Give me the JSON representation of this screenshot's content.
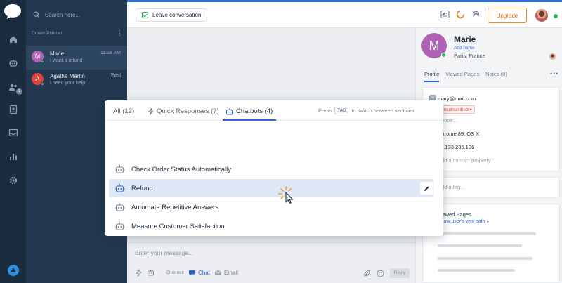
{
  "colors": {
    "accent": "#2a66d6",
    "upgrade": "#e86f12",
    "online": "#2dbd5b",
    "rail": "#1b2c3f",
    "list": "#233850",
    "avatar_marie": "#b063b6",
    "avatar_agathe": "#e0453a"
  },
  "rail": {
    "icons": [
      "chat-bubble-logo-icon",
      "home-icon",
      "bot-icon",
      "visitors-icon",
      "contacts-icon",
      "inbox-icon",
      "analytics-icon",
      "settings-icon",
      "app-logo-icon"
    ],
    "visitors_badge": "1"
  },
  "sidebar": {
    "search_placeholder": "Search here...",
    "section_title": "Dream Planner",
    "more_icon": "more-vertical-icon",
    "conversations": [
      {
        "initial": "M",
        "name": "Marie",
        "time": "11:28 AM",
        "preview": "I want a refund"
      },
      {
        "initial": "A",
        "name": "Agathe Martin",
        "time": "Wed",
        "preview": "I need your help!"
      }
    ]
  },
  "topbar": {
    "leave_label": "Leave conversation",
    "upgrade_label": "Upgrade"
  },
  "composer": {
    "placeholder": "Enter your message...",
    "channel_label": "Channel:",
    "chat_label": "Chat",
    "email_label": "Email",
    "reply_label": "Reply"
  },
  "profile": {
    "initial": "M",
    "name": "Marie",
    "add_name": "Add name",
    "location": "Paris, France",
    "tabs": [
      "Profile",
      "Viewed Pages",
      "Notes (0)"
    ],
    "email": "mary@mail.com",
    "subscription": "Unsubscribed",
    "phone_placeholder": "Phone...",
    "browser": "Chrome 89, OS X",
    "ip": "78.133.236.106",
    "add_property": "Add a contact property...",
    "add_tag": "Add a tag...",
    "viewed_pages_title": "Viewed Pages",
    "visit_path_link": "Show user's visit path »"
  },
  "popup": {
    "tabs": [
      "All (12)",
      "Quick Responses (7)",
      "Chatbots (4)"
    ],
    "hint_prefix": "Press",
    "hint_key": "TAB",
    "hint_suffix": "to switch between sections",
    "items": [
      "Check Order Status Automatically",
      "Refund",
      "Automate Repetitive Answers",
      "Measure Customer Satisfaction"
    ],
    "highlighted_index": 1
  }
}
